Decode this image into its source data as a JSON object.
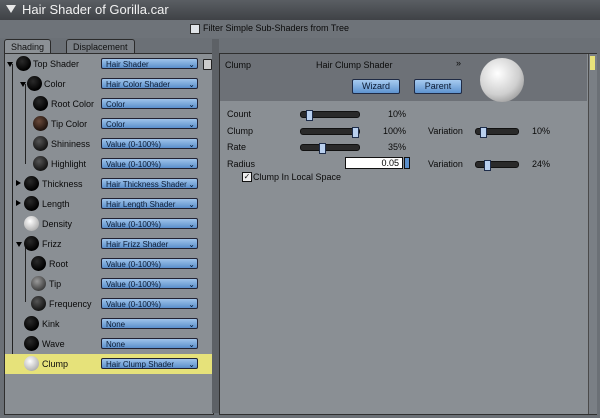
{
  "window": {
    "title": "Hair Shader of Gorilla.car"
  },
  "filter": {
    "label": "Filter Simple Sub-Shaders from Tree",
    "checked": false
  },
  "tabs": [
    {
      "label": "Shading",
      "active": true
    },
    {
      "label": "Displacement",
      "active": false
    }
  ],
  "tree": {
    "rows": [
      {
        "label": "Top Shader",
        "value": "Hair Shader"
      },
      {
        "label": "Color",
        "value": "Hair Color Shader"
      },
      {
        "label": "Root Color",
        "value": "Color"
      },
      {
        "label": "Tip Color",
        "value": "Color"
      },
      {
        "label": "Shininess",
        "value": "Value (0-100%)"
      },
      {
        "label": "Highlight",
        "value": "Value (0-100%)"
      },
      {
        "label": "Thickness",
        "value": "Hair Thickness Shader"
      },
      {
        "label": "Length",
        "value": "Hair Length Shader"
      },
      {
        "label": "Density",
        "value": "Value (0-100%)"
      },
      {
        "label": "Frizz",
        "value": "Hair Frizz Shader"
      },
      {
        "label": "Root",
        "value": "Value (0-100%)"
      },
      {
        "label": "Tip",
        "value": "Value (0-100%)"
      },
      {
        "label": "Frequency",
        "value": "Value (0-100%)"
      },
      {
        "label": "Kink",
        "value": "None"
      },
      {
        "label": "Wave",
        "value": "None"
      },
      {
        "label": "Clump",
        "value": "Hair Clump Shader",
        "selected": true
      }
    ]
  },
  "panel": {
    "title": "Clump",
    "shader": "Hair Clump Shader",
    "wizard_label": "Wizard",
    "parent_label": "Parent",
    "params": {
      "count": {
        "label": "Count",
        "value": "10%",
        "level": 0.1
      },
      "clump": {
        "label": "Clump",
        "value": "100%",
        "level": 1.0
      },
      "rate": {
        "label": "Rate",
        "value": "35%",
        "level": 0.35
      },
      "radius": {
        "label": "Radius",
        "value": "0.05"
      },
      "clump_variation": {
        "label": "Variation",
        "value": "10%",
        "level": 0.1
      },
      "radius_variation": {
        "label": "Variation",
        "value": "24%",
        "level": 0.24
      }
    },
    "local_space": {
      "label": "Clump In Local Space",
      "checked": true
    }
  }
}
